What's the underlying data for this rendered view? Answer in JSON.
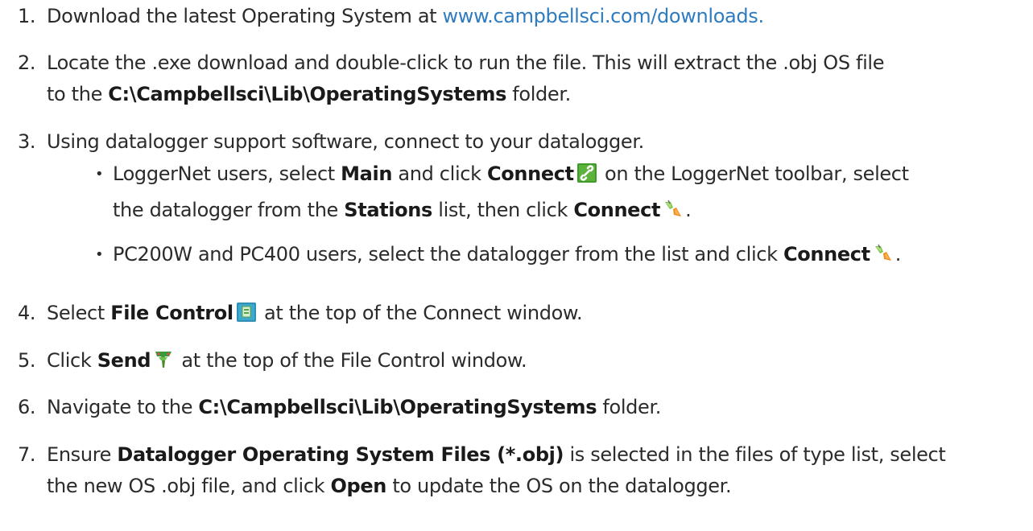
{
  "steps": [
    {
      "num": "1.",
      "text_1": "Download the latest Operating System at ",
      "link": "www.campbellsci.com/downloads."
    },
    {
      "num": "2.",
      "text_1": "Locate the .exe download and double-click to run the file. This will extract the .obj OS file",
      "text_2": "to the ",
      "bold_1": "C:\\Campbellsci\\Lib\\OperatingSystems",
      "text_3": " folder."
    },
    {
      "num": "3.",
      "text_1": "Using datalogger support software, connect to your datalogger.",
      "bullets": [
        {
          "text_1": "LoggerNet users, select ",
          "bold_1": "Main",
          "text_2": " and click ",
          "bold_2": "Connect",
          "icon_1": "chain-link-icon",
          "text_3": " on the LoggerNet toolbar, select",
          "text_4": "the datalogger from the ",
          "bold_3": "Stations",
          "text_5": " list, then click ",
          "bold_4": "Connect",
          "icon_2": "connect-plug-icon",
          "text_6": "."
        },
        {
          "text_1": "PC200W and PC400 users, select the datalogger from the list and click ",
          "bold_1": "Connect",
          "icon_1": "connect-plug-icon",
          "text_2": "."
        }
      ]
    },
    {
      "num": "4.",
      "text_1": "Select ",
      "bold_1": "File Control",
      "icon_1": "file-control-icon",
      "text_2": " at the top of the Connect window."
    },
    {
      "num": "5.",
      "text_1": "Click ",
      "bold_1": "Send",
      "icon_1": "send-icon",
      "text_2": " at the top of the File Control window."
    },
    {
      "num": "6.",
      "text_1": "Navigate to the ",
      "bold_1": "C:\\Campbellsci\\Lib\\OperatingSystems",
      "text_2": " folder."
    },
    {
      "num": "7.",
      "text_1": "Ensure ",
      "bold_1": "Datalogger Operating System Files (*.obj)",
      "text_2": " is selected in the files of type list, select",
      "text_3": "the new OS .obj file, and click ",
      "bold_2": "Open",
      "text_4": " to update the OS on the datalogger."
    }
  ],
  "colors": {
    "text": "#2b2b2b",
    "link": "#2f7bc0"
  }
}
